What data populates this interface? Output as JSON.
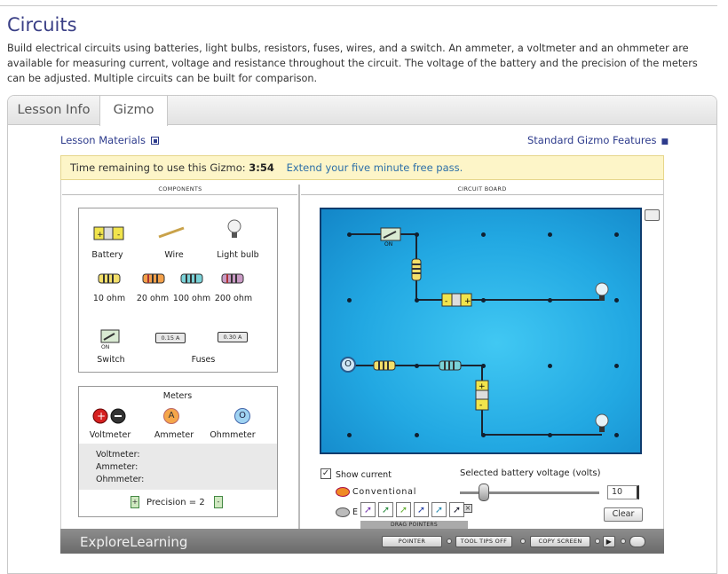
{
  "page": {
    "title": "Circuits",
    "description": "Build electrical circuits using batteries, light bulbs, resistors, fuses, wires, and a switch. An ammeter, a voltmeter and an ohmmeter are available for measuring current, voltage and resistance throughout the circuit. The voltage of the battery and the precision of the meters can be adjusted. Multiple circuits can be built for comparison."
  },
  "tabs": [
    {
      "label": "Lesson Info"
    },
    {
      "label": "Gizmo"
    }
  ],
  "links": {
    "lesson_materials": "Lesson Materials",
    "standard_features": "Standard Gizmo Features"
  },
  "timer": {
    "label": "Time remaining to use this Gizmo:",
    "value": "3:54",
    "extend": "Extend your five minute free pass."
  },
  "components": {
    "header": "COMPONENTS",
    "items": [
      "Battery",
      "Wire",
      "Light bulb"
    ],
    "resistors": [
      "10 ohm",
      "20 ohm",
      "100 ohm",
      "200 ohm"
    ],
    "switch_label": "Switch",
    "switch_state": "ON",
    "fuses_label": "Fuses",
    "fuse_values": [
      "0.15 A",
      "0.30 A"
    ]
  },
  "meters": {
    "header": "Meters",
    "items": [
      {
        "label": "Voltmeter"
      },
      {
        "label": "Ammeter",
        "glyph": "A"
      },
      {
        "label": "Ohmmeter",
        "glyph": "O"
      }
    ],
    "readings": [
      "Voltmeter:",
      "Ammeter:",
      "Ohmmeter:"
    ],
    "precision": "Precision = 2"
  },
  "board": {
    "header": "CIRCUIT BOARD",
    "switch_state": "ON",
    "show_current": "Show current",
    "conventional": "Conventional",
    "electron_prefix": "E",
    "voltage_label": "Selected battery voltage (volts)",
    "voltage_value": "10",
    "voltage_fraction": 0.17,
    "clear": "Clear",
    "drag_pointers": "DRAG POINTERS"
  },
  "bottom": {
    "brand": "ExploreLearning",
    "pointer": "POINTER",
    "tooltips": "TOOL TIPS OFF",
    "copy": "COPY SCREEN"
  }
}
